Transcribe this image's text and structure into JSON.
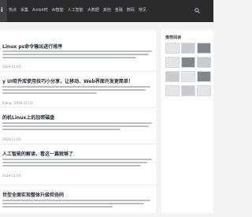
{
  "header": {
    "logo_text": "i",
    "nav": [
      "热点",
      "采集",
      "Ambit时",
      "AI智能",
      "人工智能",
      "大数据",
      "其他",
      "金融",
      "数码",
      "常见"
    ]
  },
  "articles": [
    {
      "title": "Linux ps命令输出进行排序",
      "meta": "2024-11-03"
    },
    {
      "title": "y UI软件库使用技巧小分享，让移动、Web界面开发更简单！",
      "meta": "Klang · 2024-11-03"
    },
    {
      "title": "的机Linux上的加密磁盘",
      "meta": "2024-11-03"
    },
    {
      "title": "人工智能的解读，看这一篇就够了",
      "meta": "2024-11-03"
    },
    {
      "title": "世型全面实现整体升级和协同",
      "meta": ""
    }
  ],
  "sidebar": {
    "title": "推荐阅读"
  }
}
